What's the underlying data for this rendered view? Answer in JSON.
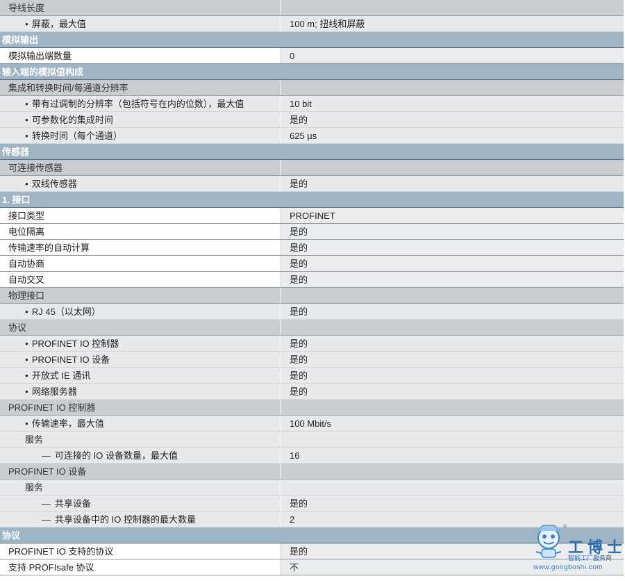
{
  "rows": [
    {
      "kind": "subhead",
      "level": 0,
      "bullet": "",
      "label": "导线长度",
      "value": ""
    },
    {
      "kind": "item",
      "level": 1,
      "bullet": "dot",
      "label": "屏蔽，最大值",
      "value": "100 m; 扭线和屏蔽"
    },
    {
      "kind": "section",
      "level": 0,
      "bullet": "",
      "label": "模拟输出",
      "value": ""
    },
    {
      "kind": "plain",
      "level": 0,
      "bullet": "",
      "label": "模拟输出端数量",
      "value": "0"
    },
    {
      "kind": "section",
      "level": 0,
      "bullet": "",
      "label": "输入端的模拟值构成",
      "value": ""
    },
    {
      "kind": "subhead",
      "level": 0,
      "bullet": "",
      "label": "集成和转换时间/每通道分辨率",
      "value": ""
    },
    {
      "kind": "item",
      "level": 1,
      "bullet": "dot",
      "label": "带有过调制的分辨率（包括符号在内的位数），最大值",
      "value": "10 bit"
    },
    {
      "kind": "item",
      "level": 1,
      "bullet": "dot",
      "label": "可参数化的集成时间",
      "value": "是的"
    },
    {
      "kind": "item",
      "level": 1,
      "bullet": "dot",
      "label": "转换时间（每个通道）",
      "value": "625 µs"
    },
    {
      "kind": "section",
      "level": 0,
      "bullet": "",
      "label": "传感器",
      "value": ""
    },
    {
      "kind": "subhead",
      "level": 0,
      "bullet": "",
      "label": "可连接传感器",
      "value": ""
    },
    {
      "kind": "item",
      "level": 1,
      "bullet": "dot",
      "label": "双线传感器",
      "value": "是的"
    },
    {
      "kind": "section",
      "level": 0,
      "bullet": "",
      "label": "1. 接口",
      "value": ""
    },
    {
      "kind": "plain",
      "level": 0,
      "bullet": "",
      "label": "接口类型",
      "value": "PROFINET"
    },
    {
      "kind": "plain",
      "level": 0,
      "bullet": "",
      "label": "电位隔离",
      "value": "是的"
    },
    {
      "kind": "plain",
      "level": 0,
      "bullet": "",
      "label": "传输速率的自动计算",
      "value": "是的"
    },
    {
      "kind": "plain",
      "level": 0,
      "bullet": "",
      "label": "自动协商",
      "value": "是的"
    },
    {
      "kind": "plain",
      "level": 0,
      "bullet": "",
      "label": "自动交叉",
      "value": "是的"
    },
    {
      "kind": "subhead",
      "level": 0,
      "bullet": "",
      "label": "物理接口",
      "value": ""
    },
    {
      "kind": "item",
      "level": 1,
      "bullet": "dot",
      "label": "RJ 45（以太网）",
      "value": "是的"
    },
    {
      "kind": "subhead",
      "level": 0,
      "bullet": "",
      "label": "协议",
      "value": ""
    },
    {
      "kind": "item",
      "level": 1,
      "bullet": "dot",
      "label": "PROFINET IO 控制器",
      "value": "是的"
    },
    {
      "kind": "item",
      "level": 1,
      "bullet": "dot",
      "label": "PROFINET IO 设备",
      "value": "是的"
    },
    {
      "kind": "item",
      "level": 1,
      "bullet": "dot",
      "label": "开放式 IE 通讯",
      "value": "是的"
    },
    {
      "kind": "item",
      "level": 1,
      "bullet": "dot",
      "label": "网络服务器",
      "value": "是的"
    },
    {
      "kind": "subhead",
      "level": 0,
      "bullet": "",
      "label": "PROFINET IO 控制器",
      "value": ""
    },
    {
      "kind": "item",
      "level": 1,
      "bullet": "dot",
      "label": "传输速率，最大值",
      "value": "100 Mbit/s"
    },
    {
      "kind": "item",
      "level": 1,
      "bullet": "",
      "label": "服务",
      "value": ""
    },
    {
      "kind": "item",
      "level": 2,
      "bullet": "dash",
      "label": "可连接的 IO 设备数量，最大值",
      "value": "16"
    },
    {
      "kind": "subhead",
      "level": 0,
      "bullet": "",
      "label": "PROFINET IO 设备",
      "value": ""
    },
    {
      "kind": "item",
      "level": 1,
      "bullet": "",
      "label": "服务",
      "value": ""
    },
    {
      "kind": "item",
      "level": 2,
      "bullet": "dash",
      "label": "共享设备",
      "value": "是的"
    },
    {
      "kind": "item",
      "level": 2,
      "bullet": "dash",
      "label": "共享设备中的 IO 控制器的最大数量",
      "value": "2"
    },
    {
      "kind": "section",
      "level": 0,
      "bullet": "",
      "label": "协议",
      "value": ""
    },
    {
      "kind": "plain",
      "level": 0,
      "bullet": "",
      "label": "PROFINET IO 支持的协议",
      "value": "是的"
    },
    {
      "kind": "plain",
      "level": 0,
      "bullet": "",
      "label": "支持 PROFIsafe 协议",
      "value": "不"
    }
  ],
  "watermark": {
    "name": "工博士",
    "tagline": "智能工厂服务商",
    "url": "www.gongboshi.com",
    "color": "#2d6fb0"
  }
}
